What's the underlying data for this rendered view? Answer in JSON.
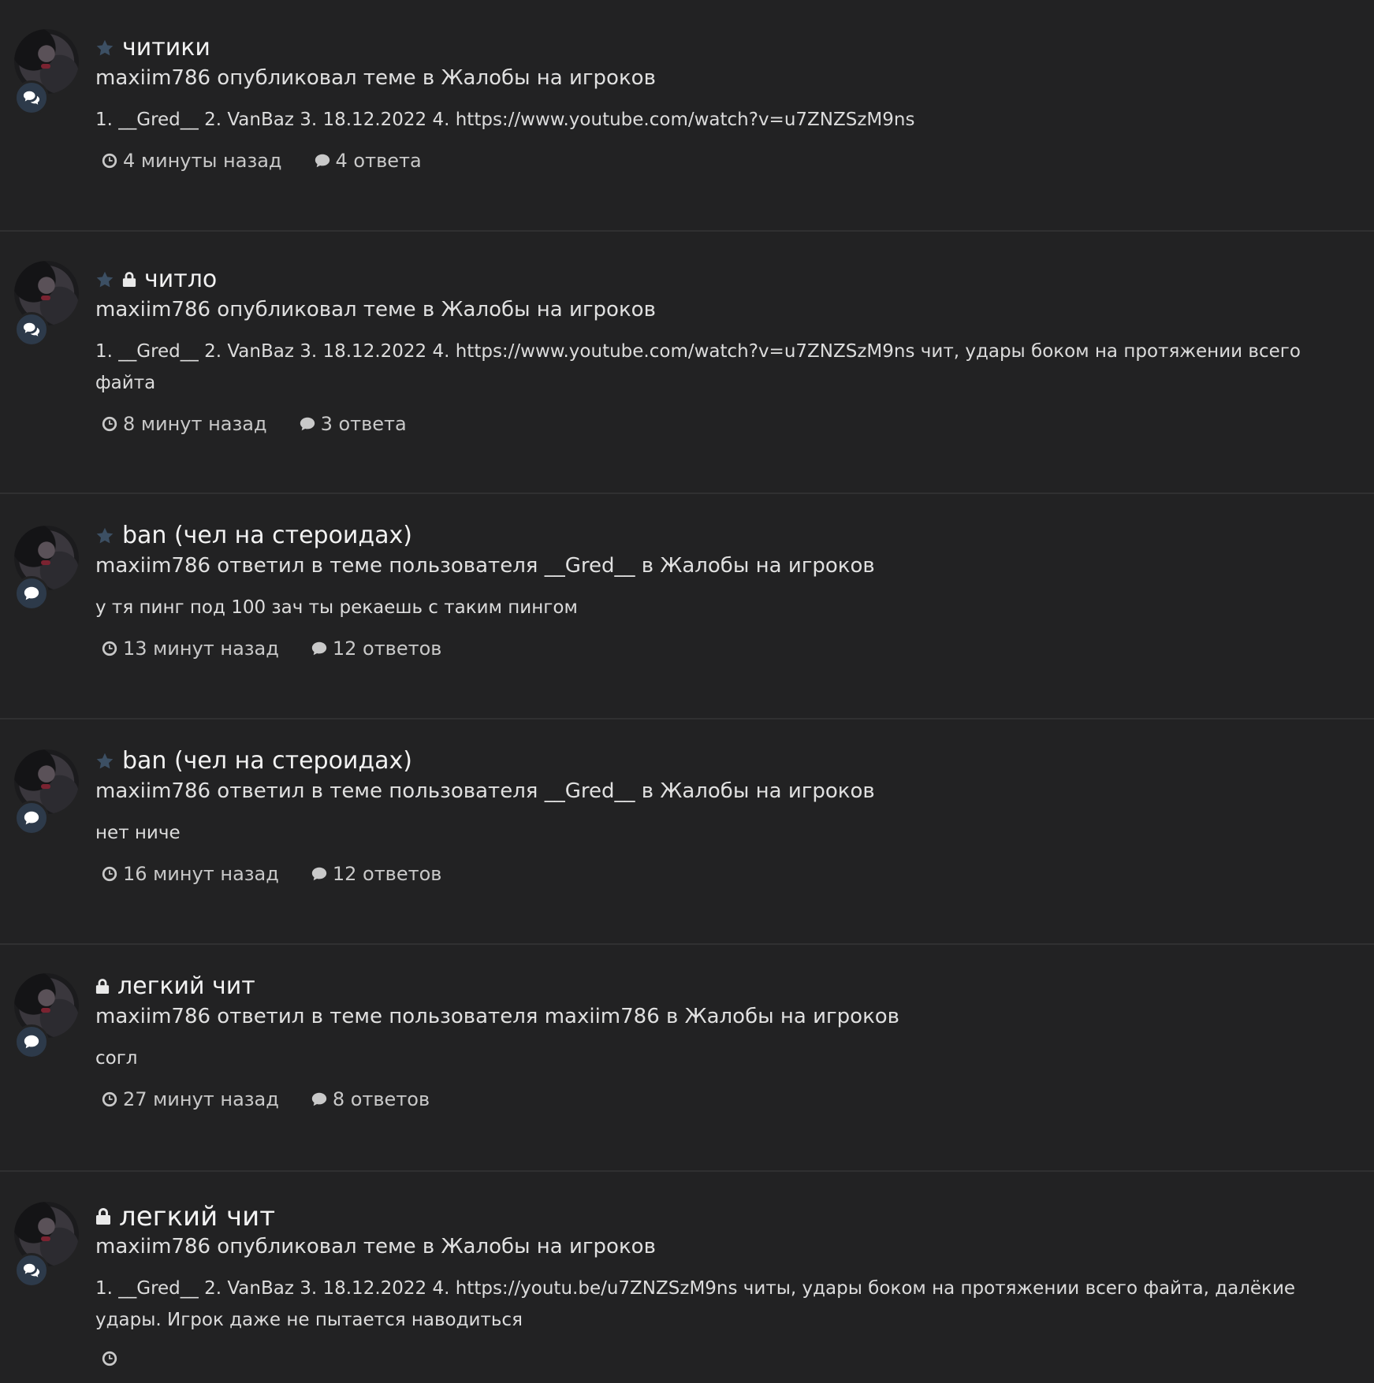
{
  "items": [
    {
      "title": "читики",
      "meta": "maxiim786 опубликовал теме в Жалобы на игроков",
      "snippet": "1. __Gred__ 2. VanBaz 3. 18.12.2022 4. https://www.youtube.com/watch?v=u7ZNZSzM9ns",
      "time": "4 минуты назад",
      "replies": "4 ответа",
      "starred": true,
      "locked": false,
      "activity_icon": "comments-icon"
    },
    {
      "title": "читло",
      "meta": "maxiim786 опубликовал теме в Жалобы на игроков",
      "snippet": "1. __Gred__ 2. VanBaz 3. 18.12.2022 4. https://www.youtube.com/watch?v=u7ZNZSzM9ns чит, удары боком на протяжении всего файта",
      "time": "8 минут назад",
      "replies": "3 ответа",
      "starred": true,
      "locked": true,
      "activity_icon": "comments-icon"
    },
    {
      "title": "ban (чел на стероидах)",
      "meta": "maxiim786 ответил в теме пользователя __Gred__ в Жалобы на игроков",
      "snippet": "у тя пинг под 100 зач ты рекаешь с таким пингом",
      "time": "13 минут назад",
      "replies": "12 ответов",
      "starred": true,
      "locked": false,
      "activity_icon": "comment-icon"
    },
    {
      "title": "ban (чел на стероидах)",
      "meta": "maxiim786 ответил в теме пользователя __Gred__ в Жалобы на игроков",
      "snippet": "нет ниче",
      "time": "16 минут назад",
      "replies": "12 ответов",
      "starred": true,
      "locked": false,
      "activity_icon": "comment-icon"
    },
    {
      "title": "легкий чит",
      "meta": "maxiim786 ответил в теме пользователя maxiim786 в Жалобы на игроков",
      "snippet": "согл",
      "time": "27 минут назад",
      "replies": "8 ответов",
      "starred": false,
      "locked": true,
      "activity_icon": "comment-icon"
    },
    {
      "title": "легкий чит",
      "meta": "maxiim786 опубликовал теме в Жалобы на игроков",
      "snippet": "1. __Gred__ 2. VanBaz 3. 18.12.2022 4. https://youtu.be/u7ZNZSzM9ns читы, удары боком на протяжении всего файта, далёкие удары. Игрок даже не пытается наводиться",
      "time": "",
      "replies": "",
      "starred": false,
      "locked": true,
      "activity_icon": "comments-icon"
    }
  ],
  "colors": {
    "background": "#222223",
    "divider": "#303031",
    "star": "#3c4f63",
    "badge": "#2d3a4a"
  }
}
